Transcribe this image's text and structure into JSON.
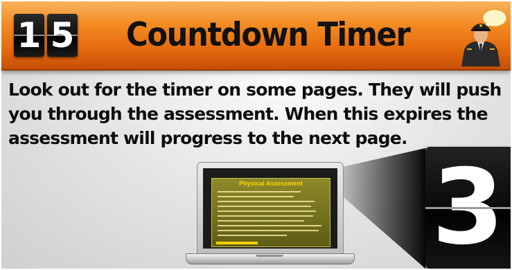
{
  "header": {
    "digit_left": "1",
    "digit_right": "5",
    "title": "Countdown Timer",
    "avatar_icon": "pilot-avatar-icon",
    "bubble_icon": "speech-bubble-icon",
    "bar_color": "#ec7a16"
  },
  "body": {
    "instructions": "Look out for the timer on some pages. They will push you through the assessment. When this expires the assessment will progress to the next page."
  },
  "illustration": {
    "laptop_screen_title": "Physical Assessment",
    "big_digit": "3"
  }
}
